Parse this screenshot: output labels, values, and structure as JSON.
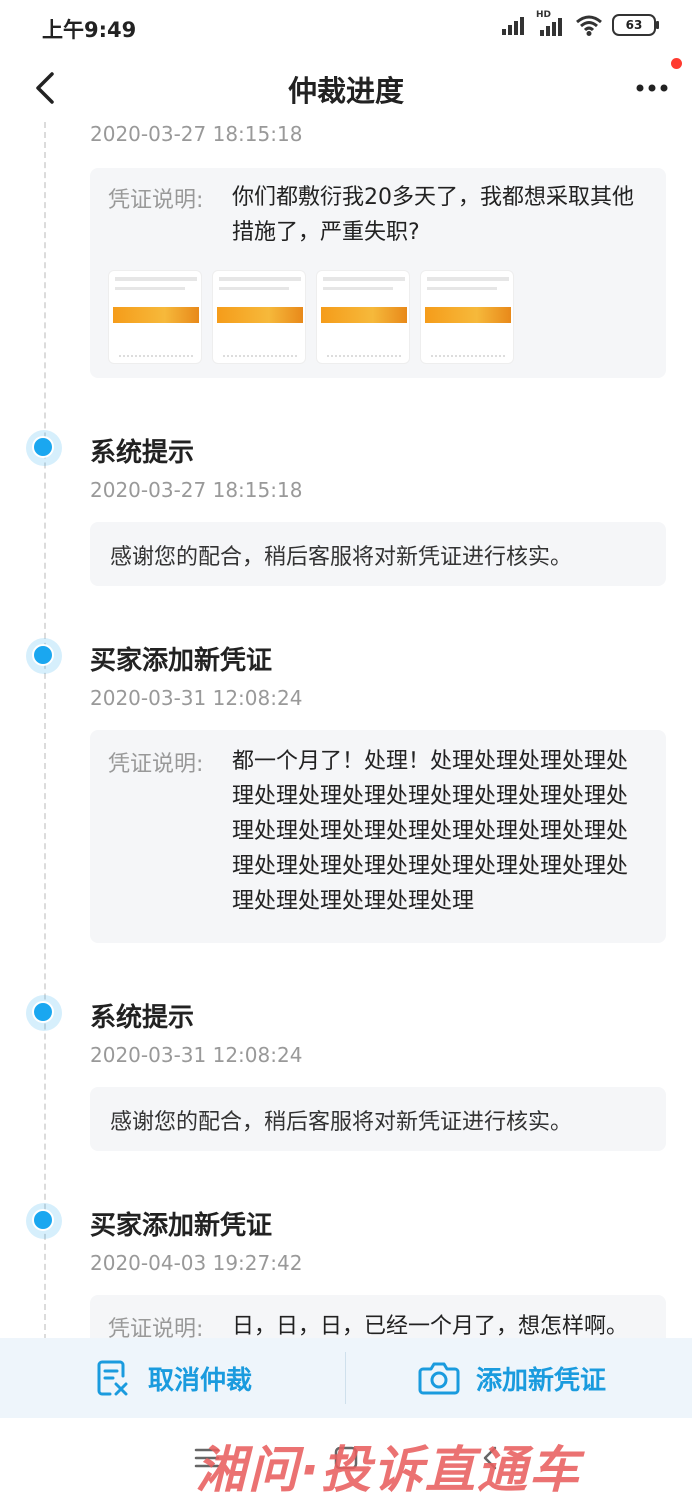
{
  "status_bar": {
    "time": "上午9:49",
    "battery": "63",
    "network_badge": "HD"
  },
  "header": {
    "title": "仲裁进度"
  },
  "entries": [
    {
      "time": "2020-03-27 18:15:18",
      "evidence_label": "凭证说明:",
      "evidence_text": "你们都敷衍我20多天了，我都想采取其他措施了，严重失职?",
      "thumbnail_count": 4
    },
    {
      "title": "系统提示",
      "time": "2020-03-27 18:15:18",
      "note": "感谢您的配合，稍后客服将对新凭证进行核实。"
    },
    {
      "title": "买家添加新凭证",
      "time": "2020-03-31 12:08:24",
      "evidence_label": "凭证说明:",
      "evidence_text": "都一个月了！处理！处理处理处理处理处理处理处理处理处理处理处理处理处理处理处理处理处理处理处理处理处理处理处理处理处理处理处理处理处理处理处理处理处理处理处理处理处理"
    },
    {
      "title": "系统提示",
      "time": "2020-03-31 12:08:24",
      "note": "感谢您的配合，稍后客服将对新凭证进行核实。"
    },
    {
      "title": "买家添加新凭证",
      "time": "2020-04-03 19:27:42",
      "evidence_label": "凭证说明:",
      "evidence_text": "日，日，日，已经一个月了，想怎样啊。"
    }
  ],
  "actions": {
    "cancel_label": "取消仲裁",
    "add_label": "添加新凭证"
  },
  "watermark": "湘问·投诉直通车",
  "colors": {
    "accent": "#1aa7f0",
    "action_text": "#1a9bde",
    "card_bg": "#f5f6f8",
    "watermark": "#e85f5f"
  }
}
